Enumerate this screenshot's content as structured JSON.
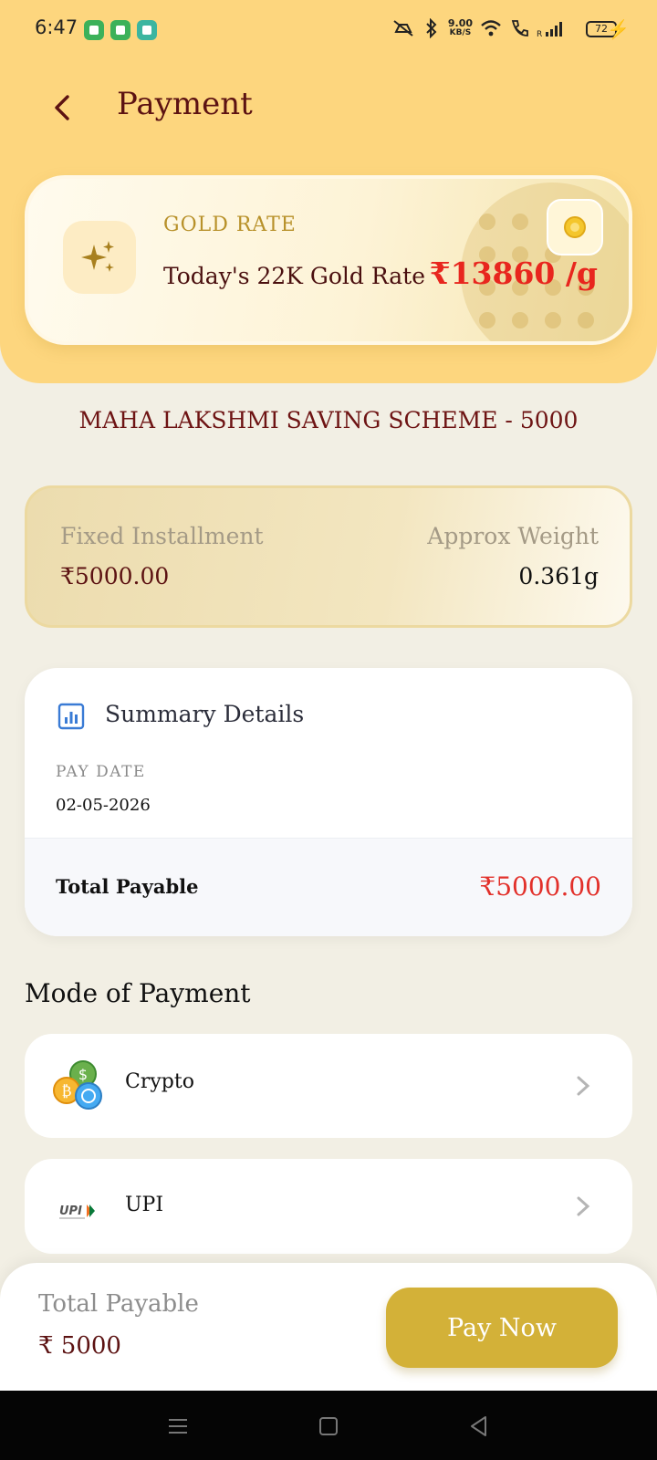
{
  "status_bar": {
    "time": "6:47",
    "speed_value": "9.00",
    "speed_unit": "KB/S",
    "battery": "72"
  },
  "header": {
    "title": "Payment"
  },
  "gold_card": {
    "label": "GOLD RATE",
    "description": "Today's 22K Gold Rate",
    "rate": "₹13860 /g"
  },
  "scheme": {
    "name": "MAHA LAKSHMI SAVING SCHEME - 5000"
  },
  "installment": {
    "fixed_label": "Fixed Installment",
    "fixed_value": "₹5000.00",
    "weight_label": "Approx Weight",
    "weight_value": "0.361g"
  },
  "summary": {
    "title": "Summary Details",
    "pay_date_label": "PAY DATE",
    "pay_date_value": "02-05-2026",
    "total_label": "Total Payable",
    "total_value": "₹5000.00"
  },
  "payment_modes": {
    "heading": "Mode of Payment",
    "options": [
      {
        "label": "Crypto",
        "icon": "crypto-coins-icon"
      },
      {
        "label": "UPI",
        "icon": "upi-logo-icon"
      }
    ]
  },
  "footer": {
    "total_label": "Total Payable",
    "total_value": "₹ 5000",
    "pay_button": "Pay Now"
  },
  "colors": {
    "header_bg": "#fdd67e",
    "accent_gold": "#d3b138",
    "maroon": "#5c1212",
    "rate_red": "#e8261e"
  }
}
